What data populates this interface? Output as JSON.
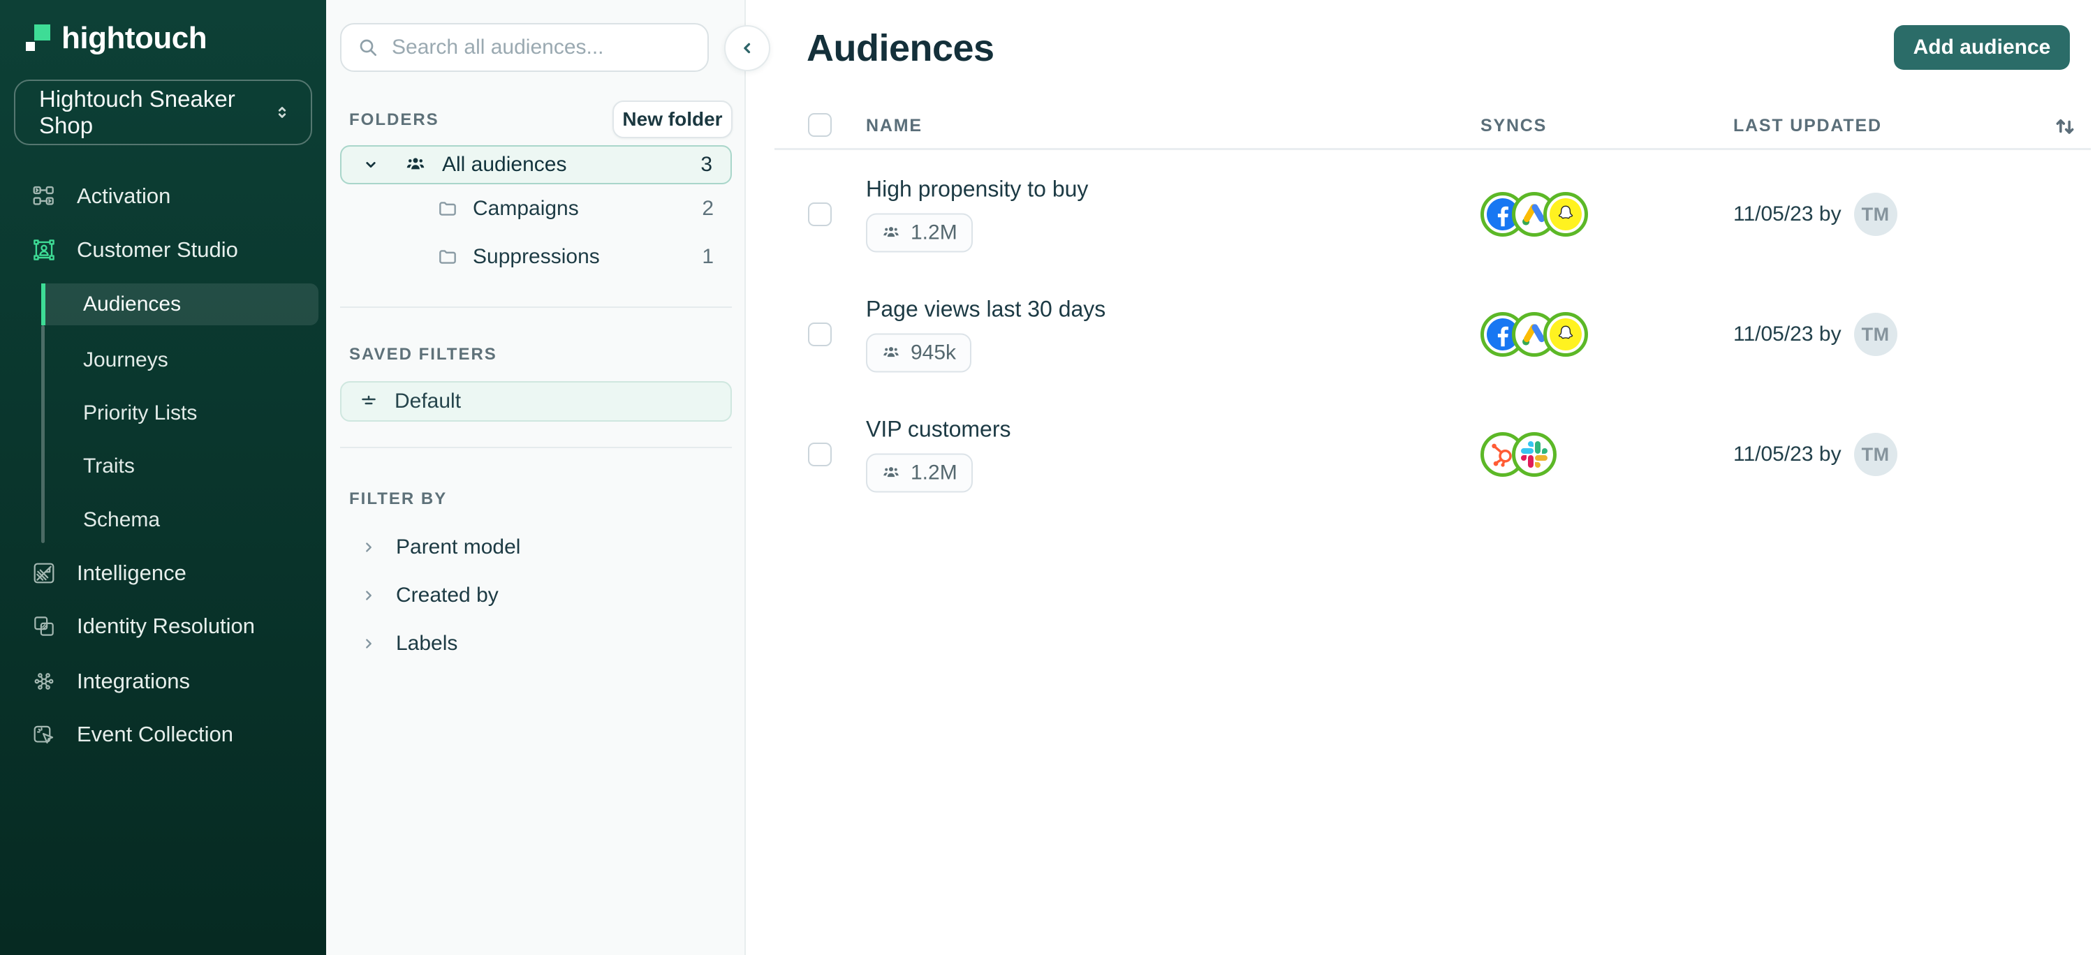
{
  "brand": {
    "logo_text": "hightouch"
  },
  "workspace": {
    "name": "Hightouch Sneaker Shop"
  },
  "sidebar": {
    "items": [
      {
        "label": "Activation",
        "icon": "activation-icon"
      },
      {
        "label": "Customer Studio",
        "icon": "customer-studio-icon"
      },
      {
        "label": "Intelligence",
        "icon": "intelligence-icon"
      },
      {
        "label": "Identity Resolution",
        "icon": "identity-resolution-icon"
      },
      {
        "label": "Integrations",
        "icon": "integrations-icon"
      },
      {
        "label": "Event Collection",
        "icon": "event-collection-icon"
      }
    ],
    "customer_studio_children": [
      {
        "label": "Audiences",
        "active": true
      },
      {
        "label": "Journeys"
      },
      {
        "label": "Priority Lists"
      },
      {
        "label": "Traits"
      },
      {
        "label": "Schema"
      }
    ]
  },
  "panel": {
    "search_placeholder": "Search all audiences...",
    "folders": {
      "header": "FOLDERS",
      "new_folder_label": "New folder",
      "rows": [
        {
          "name": "All audiences",
          "count": 3,
          "selected": true
        },
        {
          "name": "Campaigns",
          "count": 2
        },
        {
          "name": "Suppressions",
          "count": 1
        }
      ]
    },
    "saved_filters": {
      "header": "SAVED FILTERS",
      "rows": [
        {
          "name": "Default"
        }
      ]
    },
    "filter_by": {
      "header": "FILTER BY",
      "groups": [
        {
          "label": "Parent model"
        },
        {
          "label": "Created by"
        },
        {
          "label": "Labels"
        }
      ]
    }
  },
  "main": {
    "title": "Audiences",
    "add_audience_label": "Add audience",
    "table": {
      "columns": [
        "NAME",
        "SYNCS",
        "LAST UPDATED"
      ],
      "rows": [
        {
          "name": "High propensity to buy",
          "size": "1.2M",
          "syncs": [
            "facebook",
            "google-ads",
            "snapchat"
          ],
          "last_updated": "11/05/23 by",
          "avatar_initials": "TM"
        },
        {
          "name": "Page views last 30 days",
          "size": "945k",
          "syncs": [
            "facebook",
            "google-ads",
            "snapchat"
          ],
          "last_updated": "11/05/23 by",
          "avatar_initials": "TM"
        },
        {
          "name": "VIP customers",
          "size": "1.2M",
          "syncs": [
            "hubspot",
            "slack"
          ],
          "last_updated": "11/05/23 by",
          "avatar_initials": "TM"
        }
      ]
    }
  },
  "colors": {
    "accent_green": "#3edc96",
    "sidebar_top": "#0d4036",
    "sidebar_bottom": "#062a22",
    "selected_teal_bg": "#edf7f3",
    "selected_teal_border": "#a9d6ca",
    "button_teal": "#2b6c68",
    "sync_ring_green": "#5cb827",
    "facebook_blue": "#1877f2",
    "snapchat_yellow": "#fff220",
    "hubspot_orange": "#ff5c35",
    "google_ads_palette": [
      "#fbbc05",
      "#4285f4",
      "#34a853"
    ],
    "slack_palette": [
      "#36c5f0",
      "#2eb67d",
      "#ecb22e",
      "#e01e5a"
    ]
  }
}
